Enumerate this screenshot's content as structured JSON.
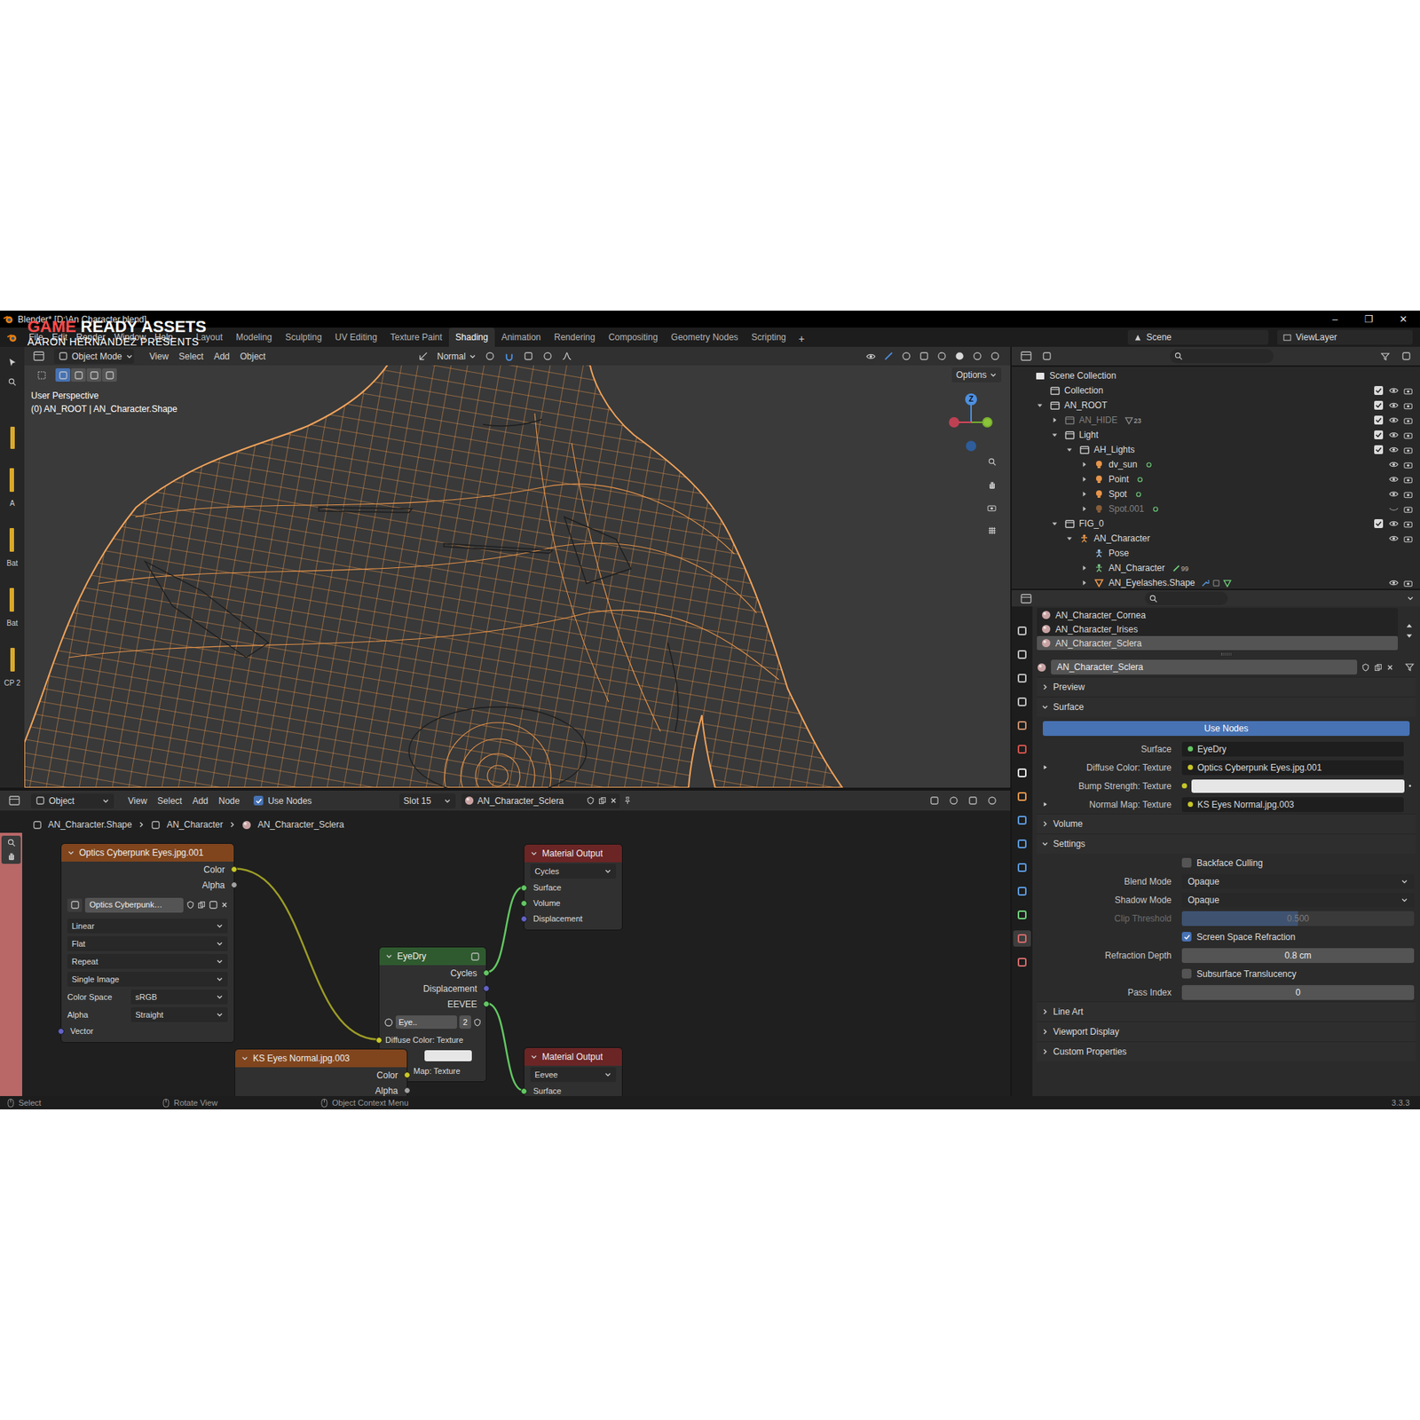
{
  "window": {
    "title": "Blender* [D:\\An Character.blend]",
    "controls": [
      "–",
      "❐",
      "✕"
    ]
  },
  "watermark": {
    "highlight": "GAME",
    "rest": "READY ASSETS",
    "subtitle": "AARON HERNANDEZ PRESENTS"
  },
  "menu": [
    "File",
    "Edit",
    "Render",
    "Window",
    "Help"
  ],
  "workspaces": [
    {
      "label": "Layout",
      "selected": false
    },
    {
      "label": "Modeling",
      "selected": false
    },
    {
      "label": "Sculpting",
      "selected": false
    },
    {
      "label": "UV Editing",
      "selected": false
    },
    {
      "label": "Texture Paint",
      "selected": false
    },
    {
      "label": "Shading",
      "selected": true
    },
    {
      "label": "Animation",
      "selected": false
    },
    {
      "label": "Rendering",
      "selected": false
    },
    {
      "label": "Compositing",
      "selected": false
    },
    {
      "label": "Geometry Nodes",
      "selected": false
    },
    {
      "label": "Scripting",
      "selected": false
    }
  ],
  "workspace_add": "+",
  "scene": "Scene",
  "view_layer": "ViewLayer",
  "left_strip": [
    "A",
    "Bat",
    "Bat",
    "CP 2"
  ],
  "viewport": {
    "mode": "Object Mode",
    "menus": [
      "View",
      "Select",
      "Add",
      "Object"
    ],
    "orientation": "Normal",
    "options": "Options",
    "overlay_title": "User Perspective",
    "overlay_object": "(0) AN_ROOT | AN_Character.Shape",
    "gizmo_axis": "Z"
  },
  "outliner": {
    "items": [
      {
        "label": "Scene Collection",
        "depth": 0,
        "kind": "scene",
        "muted": false
      },
      {
        "label": "Collection",
        "depth": 1,
        "kind": "collection",
        "muted": false,
        "checked": true,
        "visible": true
      },
      {
        "label": "AN_ROOT",
        "depth": 1,
        "kind": "collection",
        "expanded": true,
        "muted": false,
        "checked": true,
        "visible": true
      },
      {
        "label": "AN_HIDE",
        "depth": 2,
        "kind": "collection",
        "expanded": false,
        "muted": true,
        "badge": "23",
        "checked": true,
        "visible": true
      },
      {
        "label": "Light",
        "depth": 2,
        "kind": "collection",
        "expanded": true,
        "muted": false,
        "checked": true,
        "visible": true
      },
      {
        "label": "AH_Lights",
        "depth": 3,
        "kind": "collection",
        "expanded": true,
        "muted": false,
        "checked": true,
        "visible": true
      },
      {
        "label": "dv_sun",
        "depth": 4,
        "kind": "light",
        "expanded": false,
        "muted": false,
        "visible": true
      },
      {
        "label": "Point",
        "depth": 4,
        "kind": "light",
        "expanded": false,
        "muted": false,
        "visible": true
      },
      {
        "label": "Spot",
        "depth": 4,
        "kind": "light",
        "expanded": false,
        "muted": false,
        "visible": true
      },
      {
        "label": "Spot.001",
        "depth": 4,
        "kind": "light",
        "expanded": false,
        "muted": true,
        "visible": false
      },
      {
        "label": "FIG_0",
        "depth": 2,
        "kind": "collection",
        "expanded": true,
        "muted": false,
        "checked": true,
        "visible": true
      },
      {
        "label": "AN_Character",
        "depth": 3,
        "kind": "armature",
        "expanded": true,
        "muted": false,
        "visible": true
      },
      {
        "label": "Pose",
        "depth": 4,
        "kind": "pose",
        "muted": false
      },
      {
        "label": "AN_Character",
        "depth": 4,
        "kind": "armature_data",
        "expanded": false,
        "muted": false,
        "badge": "99"
      },
      {
        "label": "AN_Eyelashes.Shape",
        "depth": 4,
        "kind": "mesh",
        "expanded": false,
        "muted": false,
        "visible": true
      }
    ]
  },
  "properties": {
    "tabs": [
      {
        "kind": "tool",
        "selected": false
      },
      {
        "kind": "render",
        "selected": false
      },
      {
        "kind": "output",
        "selected": false
      },
      {
        "kind": "view_layer",
        "selected": false
      },
      {
        "kind": "scene",
        "selected": false
      },
      {
        "kind": "world",
        "selected": false
      },
      {
        "kind": "collection",
        "selected": false
      },
      {
        "kind": "object",
        "selected": false
      },
      {
        "kind": "modifiers",
        "selected": false
      },
      {
        "kind": "particles",
        "selected": false
      },
      {
        "kind": "physics",
        "selected": false
      },
      {
        "kind": "constraints",
        "selected": false
      },
      {
        "kind": "data",
        "selected": false
      },
      {
        "kind": "material",
        "selected": true
      },
      {
        "kind": "texture",
        "selected": false
      }
    ],
    "material_slots": [
      {
        "name": "AN_Character_Cornea",
        "selected": false
      },
      {
        "name": "AN_Character_Irises",
        "selected": false
      },
      {
        "name": "AN_Character_Sclera",
        "selected": true
      }
    ],
    "material": "AN_Character_Sclera",
    "sections": [
      {
        "kind": "header",
        "label": "Preview",
        "expanded": false
      },
      {
        "kind": "header",
        "label": "Surface",
        "expanded": true
      },
      {
        "kind": "button",
        "label": "Use Nodes",
        "selected": true
      },
      {
        "kind": "link",
        "label": "Surface",
        "value": "EyeDry",
        "expandable": false,
        "color": "#63c763"
      },
      {
        "kind": "link",
        "label": "Diffuse Color: Texture",
        "value": "Optics Cyberpunk Eyes.jpg.001",
        "expandable": true,
        "color": "#c7c729"
      },
      {
        "kind": "color",
        "label": "Bump Strength: Texture",
        "color": "#c7c729"
      },
      {
        "kind": "link",
        "label": "Normal Map: Texture",
        "value": "KS Eyes Normal.jpg.003",
        "expandable": true,
        "color": "#c7c729"
      },
      {
        "kind": "header",
        "label": "Volume",
        "expanded": false
      },
      {
        "kind": "header",
        "label": "Settings",
        "expanded": true
      },
      {
        "kind": "checkbox",
        "label": "Backface Culling",
        "checked": false
      },
      {
        "kind": "dropdown",
        "label": "Blend Mode",
        "value": "Opaque"
      },
      {
        "kind": "dropdown",
        "label": "Shadow Mode",
        "value": "Opaque"
      },
      {
        "kind": "slider",
        "label": "Clip Threshold",
        "value": "0.500",
        "level": 0.5,
        "disabled": true
      },
      {
        "kind": "checkbox",
        "label": "Screen Space Refraction",
        "checked": true
      },
      {
        "kind": "number",
        "label": "Refraction Depth",
        "value": "0.8 cm"
      },
      {
        "kind": "checkbox",
        "label": "Subsurface Translucency",
        "checked": false
      },
      {
        "kind": "number",
        "label": "Pass Index",
        "value": "0"
      },
      {
        "kind": "header",
        "label": "Line Art",
        "expanded": false
      },
      {
        "kind": "header",
        "label": "Viewport Display",
        "expanded": false
      },
      {
        "kind": "header",
        "label": "Custom Properties",
        "expanded": false
      }
    ]
  },
  "node_editor": {
    "editor_mode": "Object",
    "menus": [
      "View",
      "Select",
      "Add",
      "Node"
    ],
    "use_nodes": {
      "label": "Use Nodes",
      "checked": true
    },
    "slot": "Slot 15",
    "material": "AN_Character_Sclera",
    "breadcrumb": [
      "AN_Character.Shape",
      "AN_Character",
      "AN_Character_Sclera"
    ],
    "image_node": {
      "title": "Optics Cyberpunk Eyes.jpg.001",
      "outputs": [
        {
          "label": "Color",
          "color": "#c7c729"
        },
        {
          "label": "Alpha",
          "color": "#a1a1a1"
        }
      ],
      "image": "Optics Cyberpunk…",
      "options": [
        "Linear",
        "Flat",
        "Repeat",
        "Single Image"
      ],
      "fields": [
        {
          "label": "Color Space",
          "value": "sRGB"
        },
        {
          "label": "Alpha",
          "value": "Straight"
        }
      ],
      "input": {
        "label": "Vector",
        "color": "#6363c7"
      }
    },
    "output_cycles": {
      "title": "Material Output",
      "target": "Cycles",
      "inputs": [
        {
          "label": "Surface",
          "color": "#63c763"
        },
        {
          "label": "Volume",
          "color": "#63c763"
        },
        {
          "label": "Displacement",
          "color": "#6363c7"
        }
      ]
    },
    "group_node": {
      "title": "EyeDry",
      "outputs": [
        {
          "label": "Cycles",
          "color": "#63c763"
        },
        {
          "label": "Displacement",
          "color": "#6363c7"
        },
        {
          "label": "EEVEE",
          "color": "#63c763"
        }
      ],
      "datablock": "Eye..",
      "users": "2",
      "inputs": [
        {
          "label": "Diffuse Color: Texture",
          "color": "#c7c729"
        },
        {
          "label": "Map: Texture",
          "color": "#c7c729"
        }
      ]
    },
    "normal_node": {
      "title": "KS Eyes Normal.jpg.003",
      "outputs": [
        {
          "label": "Color",
          "color": "#c7c729"
        },
        {
          "label": "Alpha",
          "color": "#a1a1a1"
        }
      ]
    },
    "output_eevee": {
      "title": "Material Output",
      "target": "Eevee",
      "inputs": [
        {
          "label": "Surface",
          "color": "#63c763"
        }
      ]
    }
  },
  "status_bar": {
    "items": [
      "Select",
      "Rotate View",
      "Object Context Menu"
    ],
    "version": "3.3.3"
  }
}
